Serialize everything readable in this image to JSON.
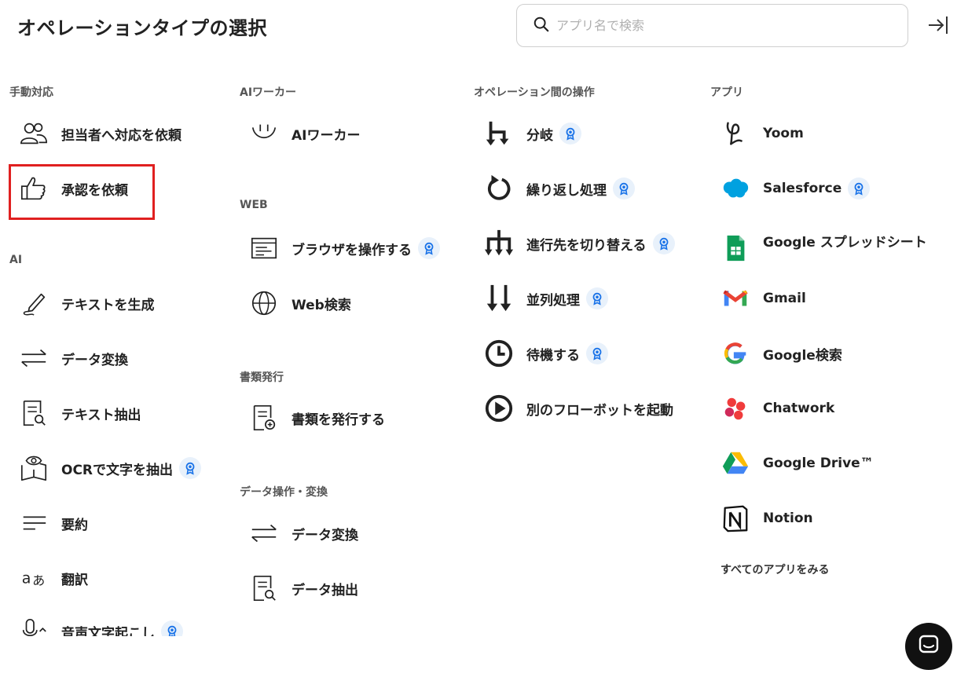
{
  "header": {
    "title": "オペレーションタイプの選択",
    "search_placeholder": "アプリ名で検索"
  },
  "sections": {
    "manual": "手動対応",
    "ai": "AI",
    "aiworker": "AIワーカー",
    "web": "WEB",
    "docs": "書類発行",
    "data_ops": "データ操作・変換",
    "ops_between": "オペレーション間の操作",
    "apps": "アプリ"
  },
  "manual_items": [
    "担当者へ対応を依頼",
    "承認を依頼"
  ],
  "ai_items": [
    "テキストを生成",
    "データ変換",
    "テキスト抽出",
    "OCRで文字を抽出",
    "要約",
    "翻訳",
    "音声文字起こし"
  ],
  "aiworker_items": [
    "AIワーカー"
  ],
  "web_items": [
    "ブラウザを操作する",
    "Web検索"
  ],
  "docs_items": [
    "書類を発行する"
  ],
  "data_items": [
    "データ変換",
    "データ抽出"
  ],
  "ops_items": [
    "分岐",
    "繰り返し処理",
    "進行先を切り替える",
    "並列処理",
    "待機する",
    "別のフローボットを起動"
  ],
  "app_items": [
    "Yoom",
    "Salesforce",
    "Google スプレッドシート",
    "Gmail",
    "Google検索",
    "Chatwork",
    "Google Drive™",
    "Notion"
  ],
  "see_all": "すべてのアプリをみる",
  "colors": {
    "highlight": "#e02020",
    "badge_bg": "#e8f1fb",
    "badge_icon": "#1a73e8"
  }
}
